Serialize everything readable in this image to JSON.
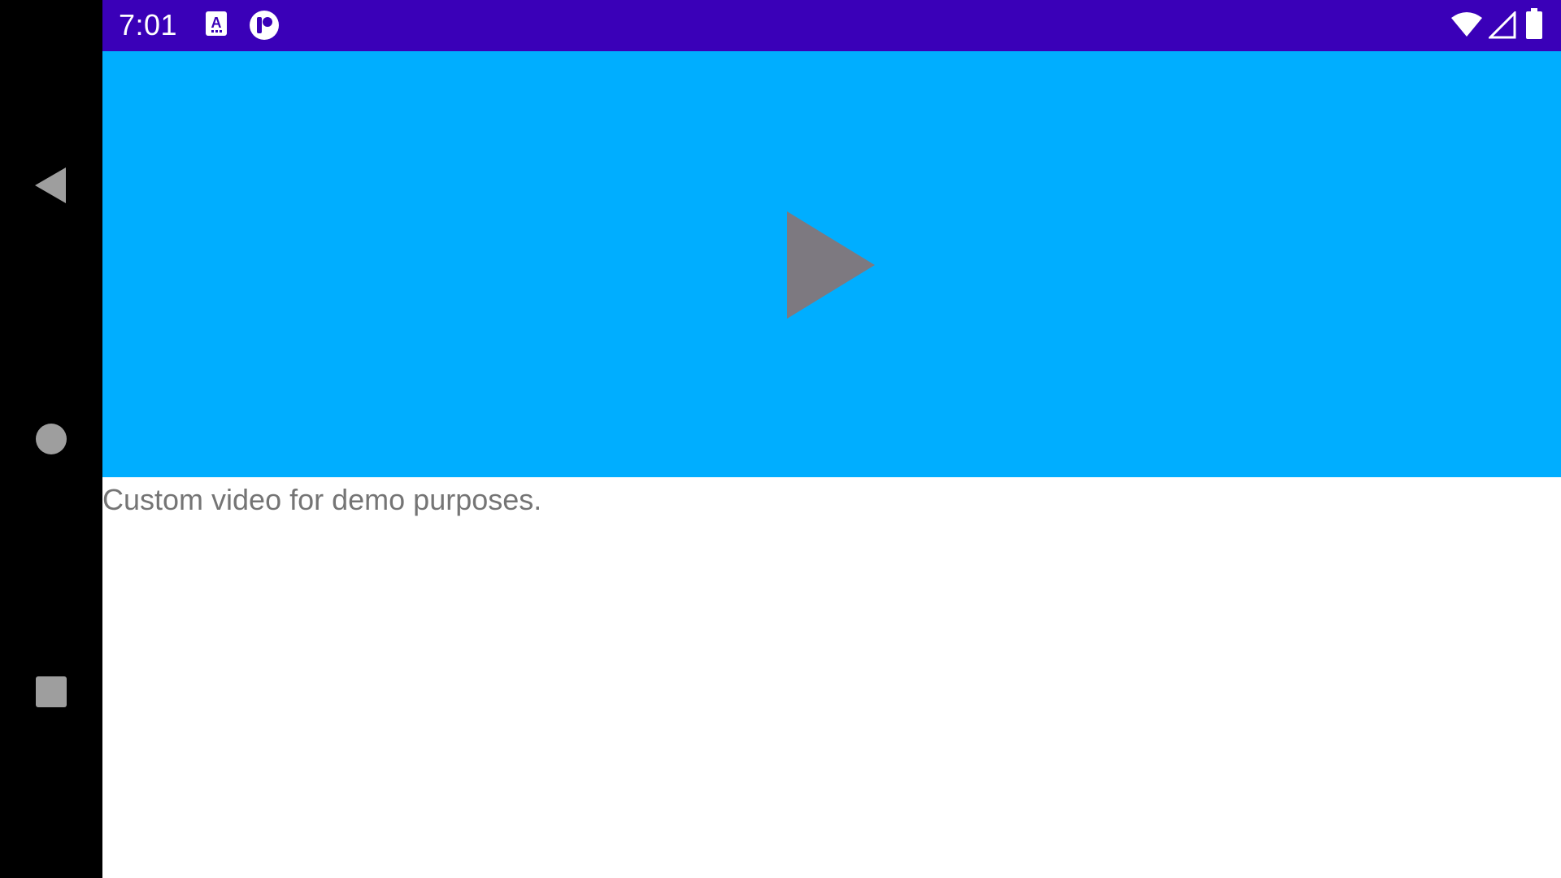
{
  "status_bar": {
    "time": "7:01",
    "background_color": "#3a00b8",
    "left_icons": [
      "a11y-menu-icon",
      "app-notification-icon"
    ],
    "right_icons": [
      "wifi-icon",
      "cell-signal-icon",
      "battery-icon"
    ]
  },
  "navigation": {
    "buttons": [
      "back-icon",
      "home-icon",
      "recents-icon"
    ],
    "icon_color": "#9e9e9e"
  },
  "video": {
    "background_color": "#00aeff",
    "play_icon_color": "#7d7980",
    "caption": "Custom video for demo purposes."
  }
}
